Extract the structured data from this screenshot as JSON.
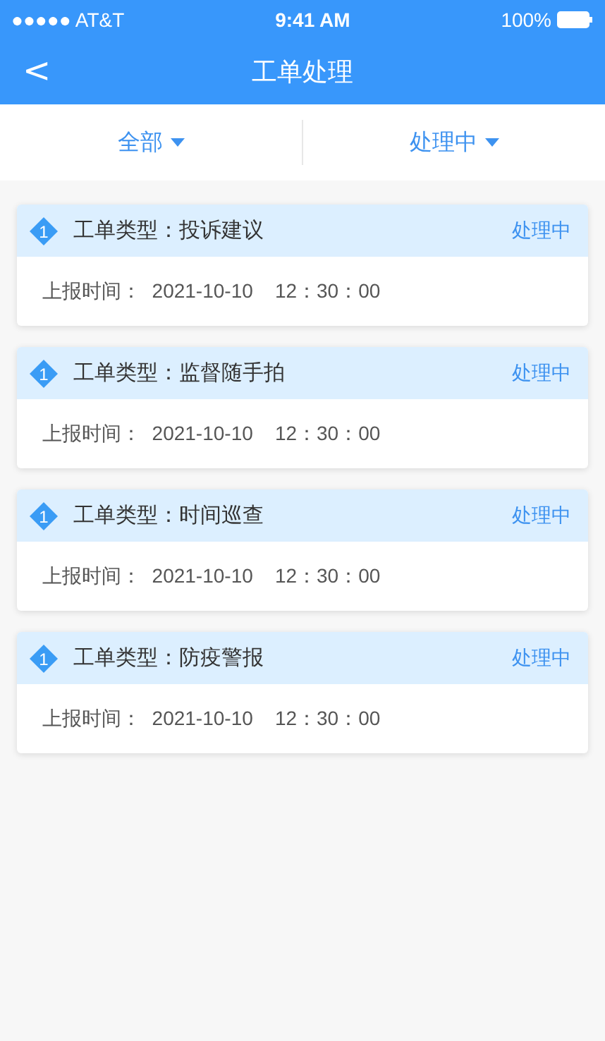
{
  "status_bar": {
    "carrier": "●●●●● AT&T",
    "time": "9:41 AM",
    "battery": "100%"
  },
  "nav": {
    "back": "<",
    "title": "工单处理"
  },
  "filters": [
    {
      "label": "全部"
    },
    {
      "label": "处理中"
    }
  ],
  "orders": [
    {
      "badge": "1",
      "type": "工单类型：投诉建议",
      "status": "处理中",
      "time": "上报时间：  2021-10-10    12：30：00"
    },
    {
      "badge": "1",
      "type": "工单类型：监督随手拍",
      "status": "处理中",
      "time": "上报时间：  2021-10-10    12：30：00"
    },
    {
      "badge": "1",
      "type": "工单类型：时间巡查",
      "status": "处理中",
      "time": "上报时间：  2021-10-10    12：30：00"
    },
    {
      "badge": "1",
      "type": "工单类型：防疫警报",
      "status": "处理中",
      "time": "上报时间：  2021-10-10    12：30：00"
    }
  ]
}
